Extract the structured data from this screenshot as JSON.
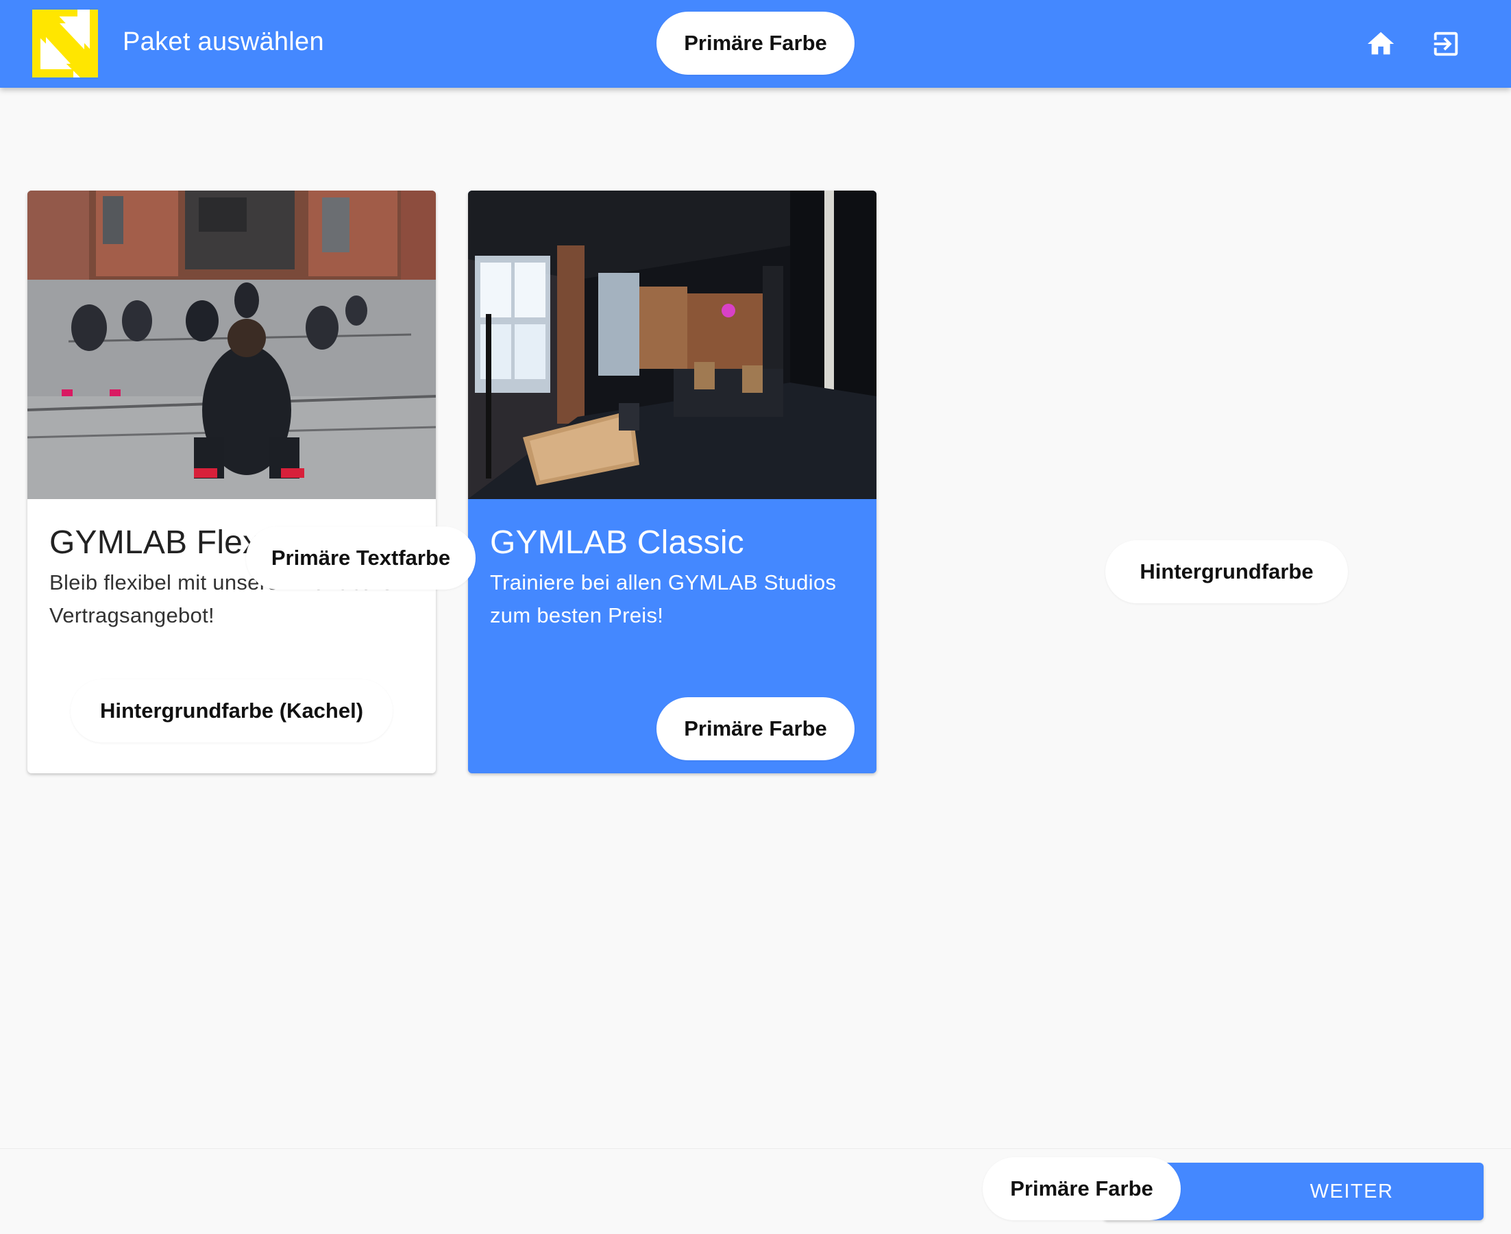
{
  "app": {
    "title": "Paket auswählen",
    "logo_icon": "gymlab-logo",
    "primary_color": "#4488ff",
    "logo_accent_color": "#ffe600"
  },
  "toolbar": {
    "home_icon": "home-icon",
    "logout_icon": "logout-icon"
  },
  "annotations": {
    "header_primary": "Primäre Farbe",
    "text_color": "Primäre Textfarbe",
    "background": "Hintergrundfarbe",
    "tile_background": "Hintergrundfarbe (Kachel)",
    "card_primary": "Primäre Farbe",
    "footer_primary": "Primäre Farbe"
  },
  "packages": [
    {
      "title": "GYMLAB Flex",
      "description": "Bleib flexibel mit unserem kündbaren Vertragsangebot!",
      "selected": false
    },
    {
      "title": "GYMLAB Classic",
      "description": "Trainiere bei allen GYMLAB Studios zum besten Preis!",
      "selected": true
    }
  ],
  "footer": {
    "next_label": "WEITER"
  }
}
